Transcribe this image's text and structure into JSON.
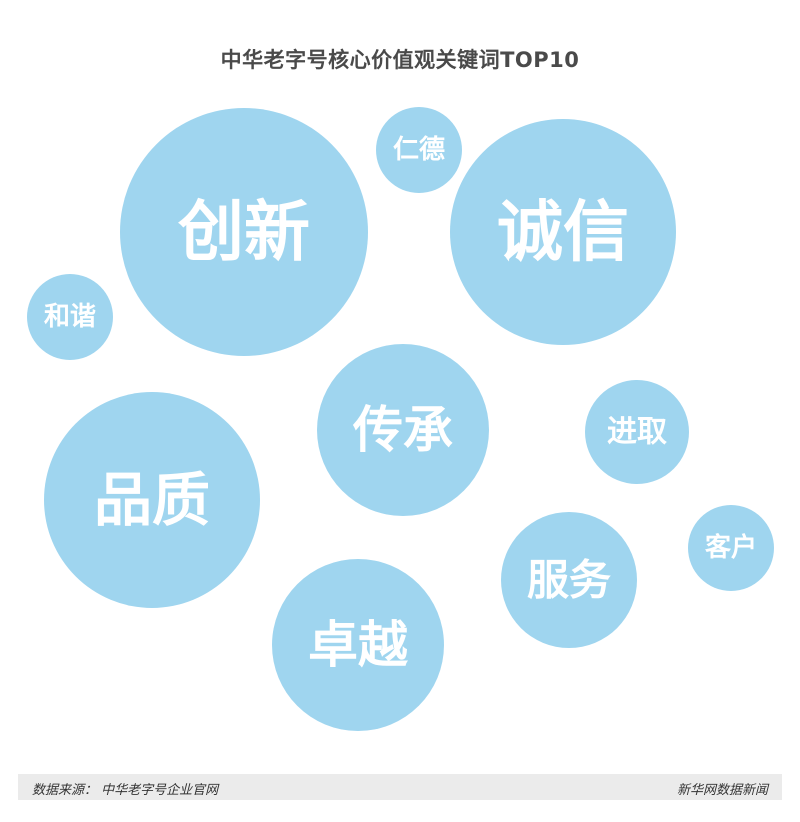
{
  "chart_data": {
    "type": "bubble",
    "title": "中华老字号核心价值观关键词TOP10",
    "color": "#9fd5ef",
    "label_color": "#ffffff",
    "keywords": [
      {
        "label": "创新",
        "rank": 1
      },
      {
        "label": "诚信",
        "rank": 2
      },
      {
        "label": "品质",
        "rank": 3
      },
      {
        "label": "卓越",
        "rank": 4
      },
      {
        "label": "传承",
        "rank": 5
      },
      {
        "label": "服务",
        "rank": 6
      },
      {
        "label": "进取",
        "rank": 7
      },
      {
        "label": "仁德",
        "rank": 8
      },
      {
        "label": "客户",
        "rank": 9
      },
      {
        "label": "和谐",
        "rank": 10
      }
    ]
  },
  "footer": {
    "source": "数据来源： 中华老字号企业官网",
    "brand": "新华网数据新闻"
  }
}
